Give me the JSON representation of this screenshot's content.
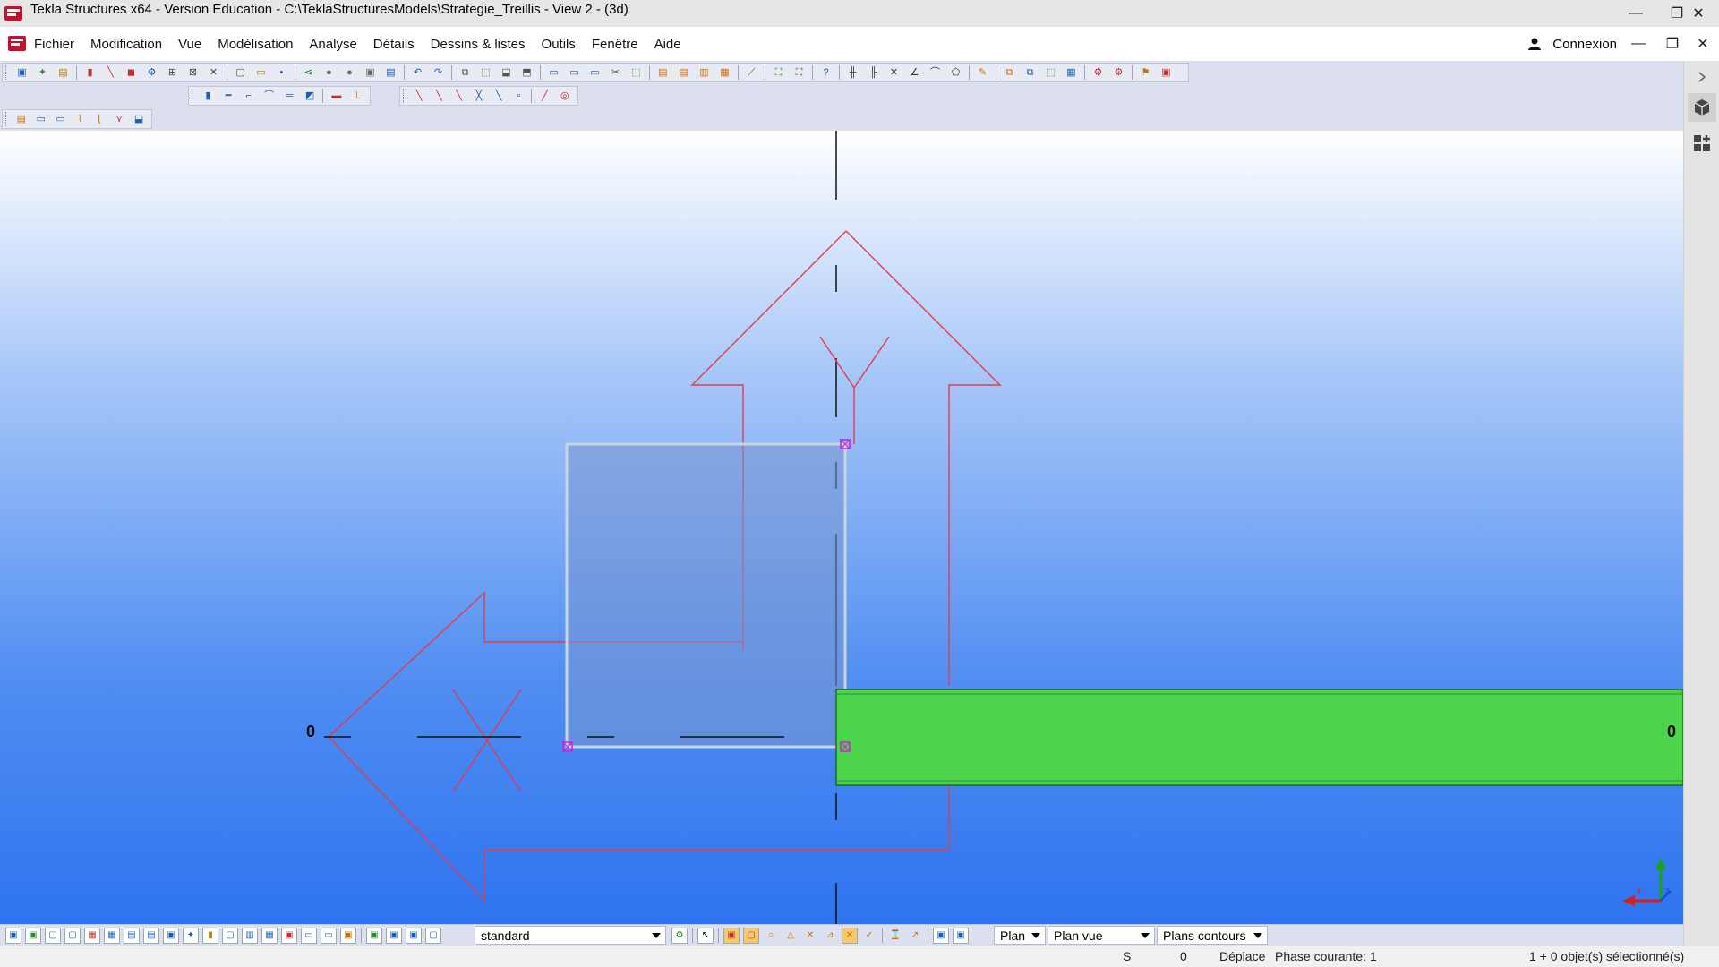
{
  "window": {
    "title": "Tekla Structures x64 - Version Education - C:\\TeklaStructuresModels\\Strategie_Treillis  - View 2 - (3d)",
    "controls": {
      "minimize": "—",
      "restore": "❐",
      "close": "✕"
    }
  },
  "menu": {
    "items": [
      "Fichier",
      "Modification",
      "Vue",
      "Modélisation",
      "Analyse",
      "Détails",
      "Dessins & listes",
      "Outils",
      "Fenêtre",
      "Aide"
    ],
    "connexion": "Connexion"
  },
  "colors": {
    "part_green": "#4cd54c",
    "outline_red": "#e03c50",
    "selection_magenta": "#d020d0",
    "viewport_bottom": "#2f74ef"
  },
  "viewport": {
    "left_label": "0",
    "right_label": "0"
  },
  "bottom_toolbar": {
    "selection_filter": "standard",
    "plane": "Plan",
    "view_plane": "Plan vue",
    "contour_planes": "Plans contours"
  },
  "status": {
    "snap": "S",
    "value": "0",
    "command": "Déplace",
    "phase": "Phase courante: 1",
    "selection": "1 + 0 objet(s) sélectionné(s)"
  },
  "icons": {
    "app": "tekla-logo-icon",
    "user": "user-icon",
    "panel_expand": "chevron-right-icon",
    "panel_3d": "cube-icon",
    "panel_apps": "applications-icon",
    "axes": "coordinate-axes-icon"
  }
}
